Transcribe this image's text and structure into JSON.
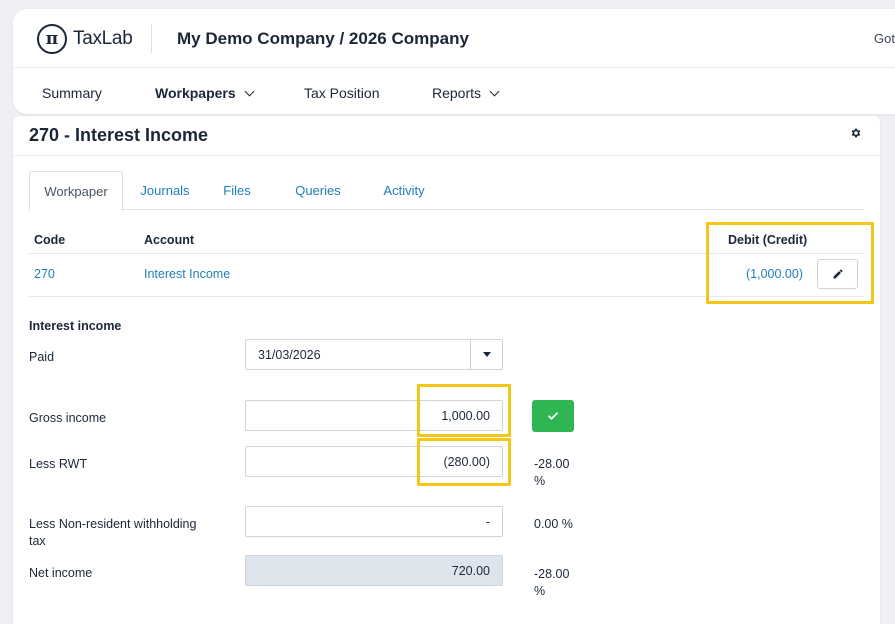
{
  "brand": {
    "name": "TaxLab",
    "logo_glyph": "π"
  },
  "header": {
    "company": "My Demo Company / 2026 Company",
    "user_fragment": "Got"
  },
  "nav": {
    "items": [
      {
        "label": "Summary"
      },
      {
        "label": "Workpapers"
      },
      {
        "label": "Tax Position"
      },
      {
        "label": "Reports"
      }
    ]
  },
  "panel": {
    "title": "270 - Interest Income"
  },
  "tabs": [
    {
      "label": "Workpaper"
    },
    {
      "label": "Journals"
    },
    {
      "label": "Files"
    },
    {
      "label": "Queries"
    },
    {
      "label": "Activity"
    }
  ],
  "table": {
    "headers": {
      "code": "Code",
      "account": "Account",
      "amount": "Debit (Credit)"
    },
    "rows": [
      {
        "code": "270",
        "account": "Interest Income",
        "amount": "(1,000.00)"
      }
    ]
  },
  "form": {
    "section": "Interest income",
    "paid": {
      "label": "Paid",
      "value": "31/03/2026"
    },
    "gross": {
      "label": "Gross income",
      "value": "1,000.00"
    },
    "rwt": {
      "label": "Less RWT",
      "value": "(280.00)",
      "pct_value": "-28.00",
      "pct_unit": "%"
    },
    "nrwt": {
      "label_line1": "Less Non-resident withholding",
      "label_line2": "tax",
      "value": "-",
      "pct": "0.00 %"
    },
    "net": {
      "label": "Net income",
      "value": "720.00",
      "pct_value": "-28.00",
      "pct_unit": "%"
    }
  },
  "colors": {
    "link": "#1f7fb6",
    "confirm": "#2fb552",
    "highlight": "#f5c518",
    "readonly_bg": "#dde4ec"
  }
}
